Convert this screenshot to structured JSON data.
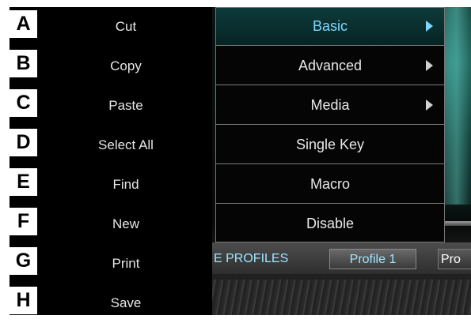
{
  "keys": [
    {
      "letter": "A",
      "label": "Cut"
    },
    {
      "letter": "B",
      "label": "Copy"
    },
    {
      "letter": "C",
      "label": "Paste"
    },
    {
      "letter": "D",
      "label": "Select All"
    },
    {
      "letter": "E",
      "label": "Find"
    },
    {
      "letter": "F",
      "label": "New"
    },
    {
      "letter": "G",
      "label": "Print"
    },
    {
      "letter": "H",
      "label": "Save"
    }
  ],
  "submenu": {
    "items": [
      {
        "label": "Basic",
        "has_submenu": true,
        "active": true
      },
      {
        "label": "Advanced",
        "has_submenu": true,
        "active": false
      },
      {
        "label": "Media",
        "has_submenu": true,
        "active": false
      },
      {
        "label": "Single Key",
        "has_submenu": false,
        "active": false
      },
      {
        "label": "Macro",
        "has_submenu": false,
        "active": false
      },
      {
        "label": "Disable",
        "has_submenu": false,
        "active": false
      }
    ],
    "arrow_icon": "chevron-right-icon"
  },
  "profiles": {
    "section_label": "E PROFILES",
    "tab1": "Profile 1",
    "tab2": "Pro"
  },
  "colors": {
    "active_text": "#7fd7ff",
    "accent_teal": "#2f8a80"
  }
}
